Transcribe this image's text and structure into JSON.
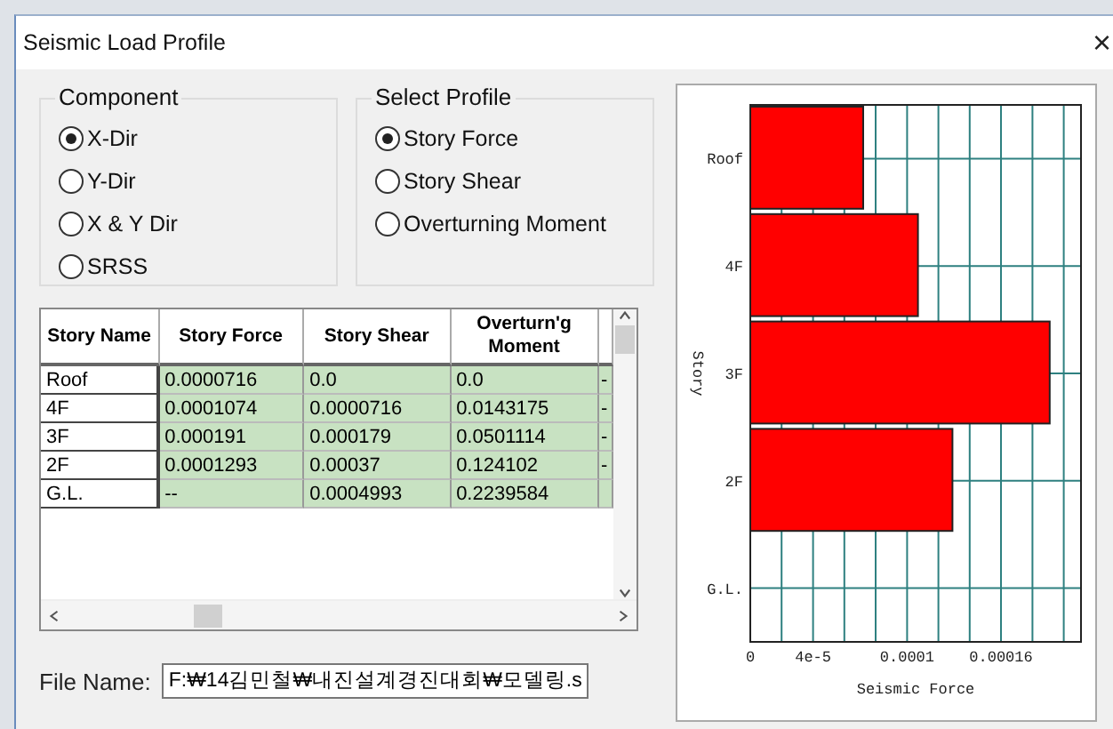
{
  "window": {
    "title": "Seismic Load Profile",
    "close": "×"
  },
  "component": {
    "title": "Component",
    "options": [
      {
        "label": "X-Dir",
        "selected": true
      },
      {
        "label": "Y-Dir",
        "selected": false
      },
      {
        "label": "X & Y Dir",
        "selected": false
      },
      {
        "label": "SRSS",
        "selected": false
      }
    ]
  },
  "profile": {
    "title": "Select Profile",
    "options": [
      {
        "label": "Story Force",
        "selected": true
      },
      {
        "label": "Story Shear",
        "selected": false
      },
      {
        "label": "Overturning Moment",
        "selected": false
      }
    ]
  },
  "table": {
    "columns": [
      "Story Name",
      "Story Force",
      "Story Shear",
      "Overturn'g Moment"
    ],
    "rows": [
      [
        "Roof",
        "0.0000716",
        "0.0",
        "0.0",
        "-"
      ],
      [
        "4F",
        "0.0001074",
        "0.0000716",
        "0.0143175",
        "-"
      ],
      [
        "3F",
        "0.000191",
        "0.000179",
        "0.0501114",
        "-"
      ],
      [
        "2F",
        "0.0001293",
        "0.00037",
        "0.124102",
        "-"
      ],
      [
        "G.L.",
        "--",
        "0.0004993",
        "0.2239584",
        ""
      ]
    ]
  },
  "file": {
    "label": "File Name:",
    "value": "F:₩14김민철₩내진설계경진대회₩모델링.s"
  },
  "chart": {
    "chart_data": {
      "type": "bar",
      "orientation": "horizontal",
      "xlabel": "Seismic Force",
      "ylabel": "Story",
      "categories": [
        "Roof",
        "4F",
        "3F",
        "2F",
        "G.L."
      ],
      "values": [
        7.2e-05,
        0.000107,
        0.000191,
        0.000129,
        null
      ],
      "xlim": [
        0,
        0.000211
      ],
      "xticks": [
        0,
        {
          "value": 4e-05,
          "label": "4e-5"
        },
        0.0001,
        0.00016
      ]
    }
  }
}
